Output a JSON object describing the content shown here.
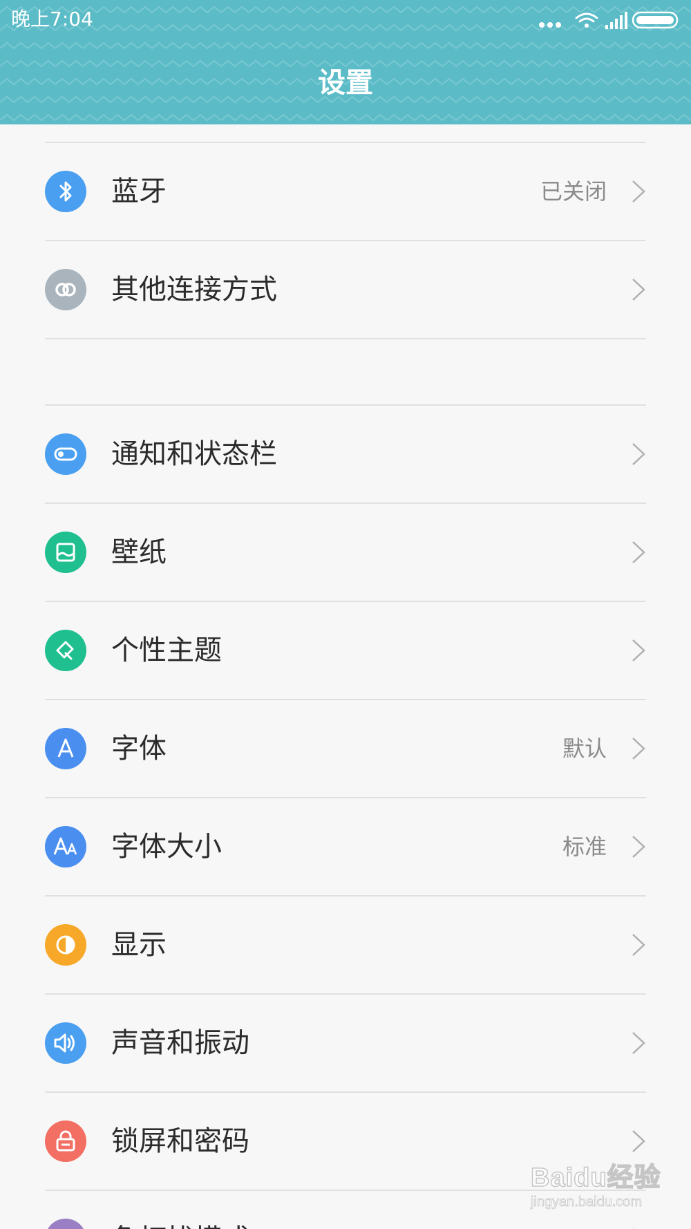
{
  "status_bar": {
    "time": "晚上7:04",
    "icons": [
      "more-dots-icon",
      "wifi-icon",
      "signal-icon",
      "battery-icon"
    ]
  },
  "header": {
    "title": "设置",
    "background_color": "#5bbcc7"
  },
  "groups": [
    {
      "items": [
        {
          "label": "蓝牙",
          "value": "已关闭",
          "icon": "bluetooth-icon",
          "icon_color": "#4a9ff0"
        },
        {
          "label": "其他连接方式",
          "value": "",
          "icon": "link-icon",
          "icon_color": "#a9b4bd"
        }
      ]
    },
    {
      "items": [
        {
          "label": "通知和状态栏",
          "value": "",
          "icon": "toggle-icon",
          "icon_color": "#4a9ff0"
        },
        {
          "label": "壁纸",
          "value": "",
          "icon": "wallpaper-icon",
          "icon_color": "#1fbf8f"
        },
        {
          "label": "个性主题",
          "value": "",
          "icon": "brush-icon",
          "icon_color": "#1fbf8f"
        },
        {
          "label": "字体",
          "value": "默认",
          "icon": "font-icon",
          "icon_color": "#4a8ff0"
        },
        {
          "label": "字体大小",
          "value": "标准",
          "icon": "font-size-icon",
          "icon_color": "#4a8ff0"
        },
        {
          "label": "显示",
          "value": "",
          "icon": "display-icon",
          "icon_color": "#f7a828"
        },
        {
          "label": "声音和振动",
          "value": "",
          "icon": "speaker-icon",
          "icon_color": "#4a9ff0"
        },
        {
          "label": "锁屏和密码",
          "value": "",
          "icon": "lock-icon",
          "icon_color": "#f36f64"
        },
        {
          "label": "免打扰模式",
          "value": "",
          "icon": "moon-icon",
          "icon_color": "#9b7fc4"
        }
      ]
    }
  ],
  "watermark": {
    "logo": "Baidu经验",
    "url": "jingyan.baidu.com"
  }
}
